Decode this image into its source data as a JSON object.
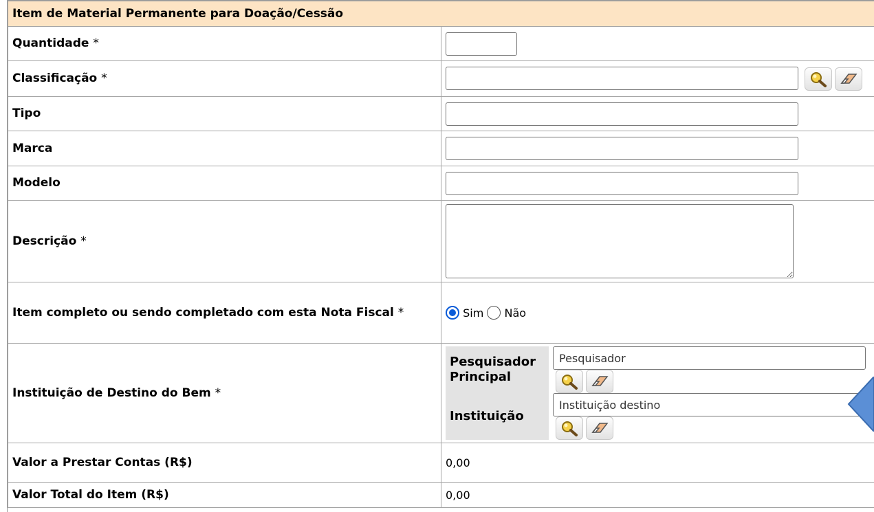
{
  "form": {
    "title": "Item de Material Permanente para Doação/Cessão",
    "fields": {
      "quantidade": {
        "label": "Quantidade",
        "required": "*",
        "value": ""
      },
      "classificacao": {
        "label": "Classificação",
        "required": "*",
        "value": ""
      },
      "tipo": {
        "label": "Tipo",
        "value": ""
      },
      "marca": {
        "label": "Marca",
        "value": ""
      },
      "modelo": {
        "label": "Modelo",
        "value": ""
      },
      "descricao": {
        "label": "Descrição",
        "required": "*",
        "value": ""
      },
      "item_completo": {
        "label": "Item completo ou sendo completado com esta Nota Fiscal",
        "required": "*",
        "options": [
          "Sim",
          "Não"
        ],
        "selected": "Sim"
      },
      "instituicao_destino": {
        "label": "Instituição de Destino do Bem",
        "required": "*",
        "pesquisador_label": "Pesquisador Principal",
        "pesquisador_value": "Pesquisador",
        "instituicao_label": "Instituição",
        "instituicao_value": "Instituição destino"
      },
      "valor_prestar_contas": {
        "label": "Valor a Prestar Contas (R$)",
        "value": "0,00"
      },
      "valor_total_item": {
        "label": "Valor Total do Item (R$)",
        "value": "0,00"
      }
    }
  },
  "icons": [
    "search-icon",
    "eraser-icon",
    "nav-arrow-icon"
  ],
  "colors": {
    "header_bg": "#fde4c4",
    "radio_accent": "#0a5bd8",
    "arrow_fill": "#5b8fd6"
  }
}
